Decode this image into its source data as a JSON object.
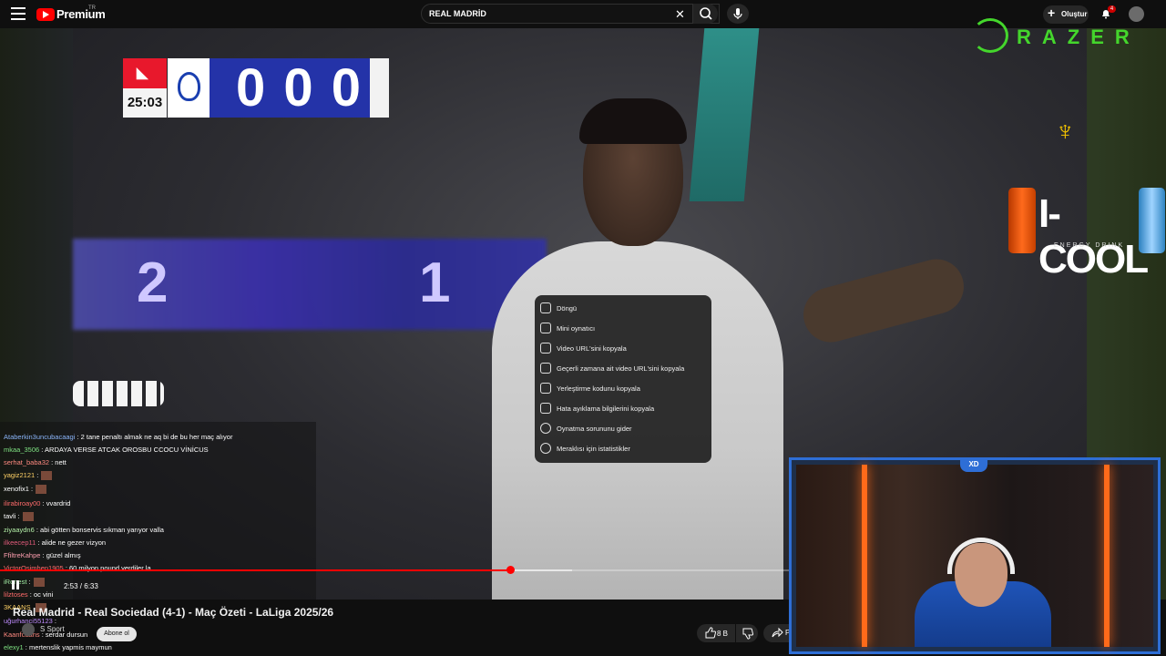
{
  "header": {
    "brand": "Premium",
    "region": "TR",
    "search_value": "REAL MADRİD",
    "create_label": "Oluştur",
    "notification_count": "4"
  },
  "scoreboard": {
    "time": "25:03",
    "score_text": "0 0 0"
  },
  "background_score": {
    "left": "2",
    "right": "1"
  },
  "sponsors": {
    "razer": "RAZER",
    "icool": "I-COOL",
    "icool_tag": "ENERGY DRINK"
  },
  "context_menu": {
    "items": [
      {
        "label": "Döngü",
        "icon": "loop-icon"
      },
      {
        "label": "Mini oynatıcı",
        "icon": "miniplayer-icon"
      },
      {
        "label": "Video URL'sini kopyala",
        "icon": "link-icon"
      },
      {
        "label": "Geçerli zamana ait video URL'sini kopyala",
        "icon": "link-time-icon"
      },
      {
        "label": "Yerleştirme kodunu kopyala",
        "icon": "embed-icon"
      },
      {
        "label": "Hata ayıklama bilgilerini kopyala",
        "icon": "bug-icon"
      },
      {
        "label": "Oynatma sorununu gider",
        "icon": "help-icon"
      },
      {
        "label": "Meraklısı için istatistikler",
        "icon": "info-icon"
      }
    ]
  },
  "chat": {
    "lines": [
      {
        "user": "Ataberkin3uncubacaagi",
        "text": ": 2 tane penaltı almak ne aq bi de bu her maç alıyor",
        "color": "#8ab4f8"
      },
      {
        "user": "mkaa_3506",
        "text": ": ARDAYA VERSE ATCAK OROSBU CCOCU VİNİCUS",
        "color": "#7ee081"
      },
      {
        "user": "serhat_baba32",
        "text": ": nett",
        "color": "#ff8a80"
      },
      {
        "user": "yagiz2121",
        "text": ":",
        "color": "#ffd166"
      },
      {
        "user": "xenofix1",
        "text": ":",
        "color": "#fff"
      },
      {
        "user": "ilirabiroay00",
        "text": ": vvardrid",
        "color": "#ff6b6b"
      },
      {
        "user": "tavli",
        "text": ":",
        "color": "#fff"
      },
      {
        "user": "ziyaaydn6",
        "text": ": abi götten bonservis sıkman yarıyor valla",
        "color": "#b4f0a8"
      },
      {
        "user": "ilkeecep11",
        "text": ": alide ne gezer vizyon",
        "color": "#e05a7a"
      },
      {
        "user": "FfiltreKahpe",
        "text": ": güzel almış",
        "color": "#ff9fb0"
      },
      {
        "user": "VictorOsimhen1905",
        "text": ": 60 milyon pound verdiler la",
        "color": "#ff6b6b"
      },
      {
        "user": "iRonest",
        "text": ":",
        "color": "#9fe8a0"
      },
      {
        "user": "lilztoses",
        "text": ": oc vini",
        "color": "#ff6b6b"
      },
      {
        "user": "3KAANS",
        "text": "",
        "color": "#ffd166"
      },
      {
        "user": "uğurhanci55123",
        "text": ":",
        "color": "#c08cff"
      },
      {
        "user": "Kaanfcaans",
        "text": ": serdar dursun",
        "color": "#ff8a80"
      },
      {
        "user": "elexy1",
        "text": ": mertenslik yapmis maymun",
        "color": "#7ee081"
      }
    ]
  },
  "player": {
    "current_time": "2:53",
    "duration": "6:33",
    "time_display": "2:53 / 6:33",
    "progress_fraction": 0.44,
    "title": "Real Madrid - Real Sociedad (4-1) - Maç Özeti - LaLiga 2025/26",
    "channel": "S Sport",
    "subscribe_label": "Abone ol",
    "likes": "8 B",
    "share_label": "P"
  },
  "webcam": {
    "badge": "XD"
  }
}
